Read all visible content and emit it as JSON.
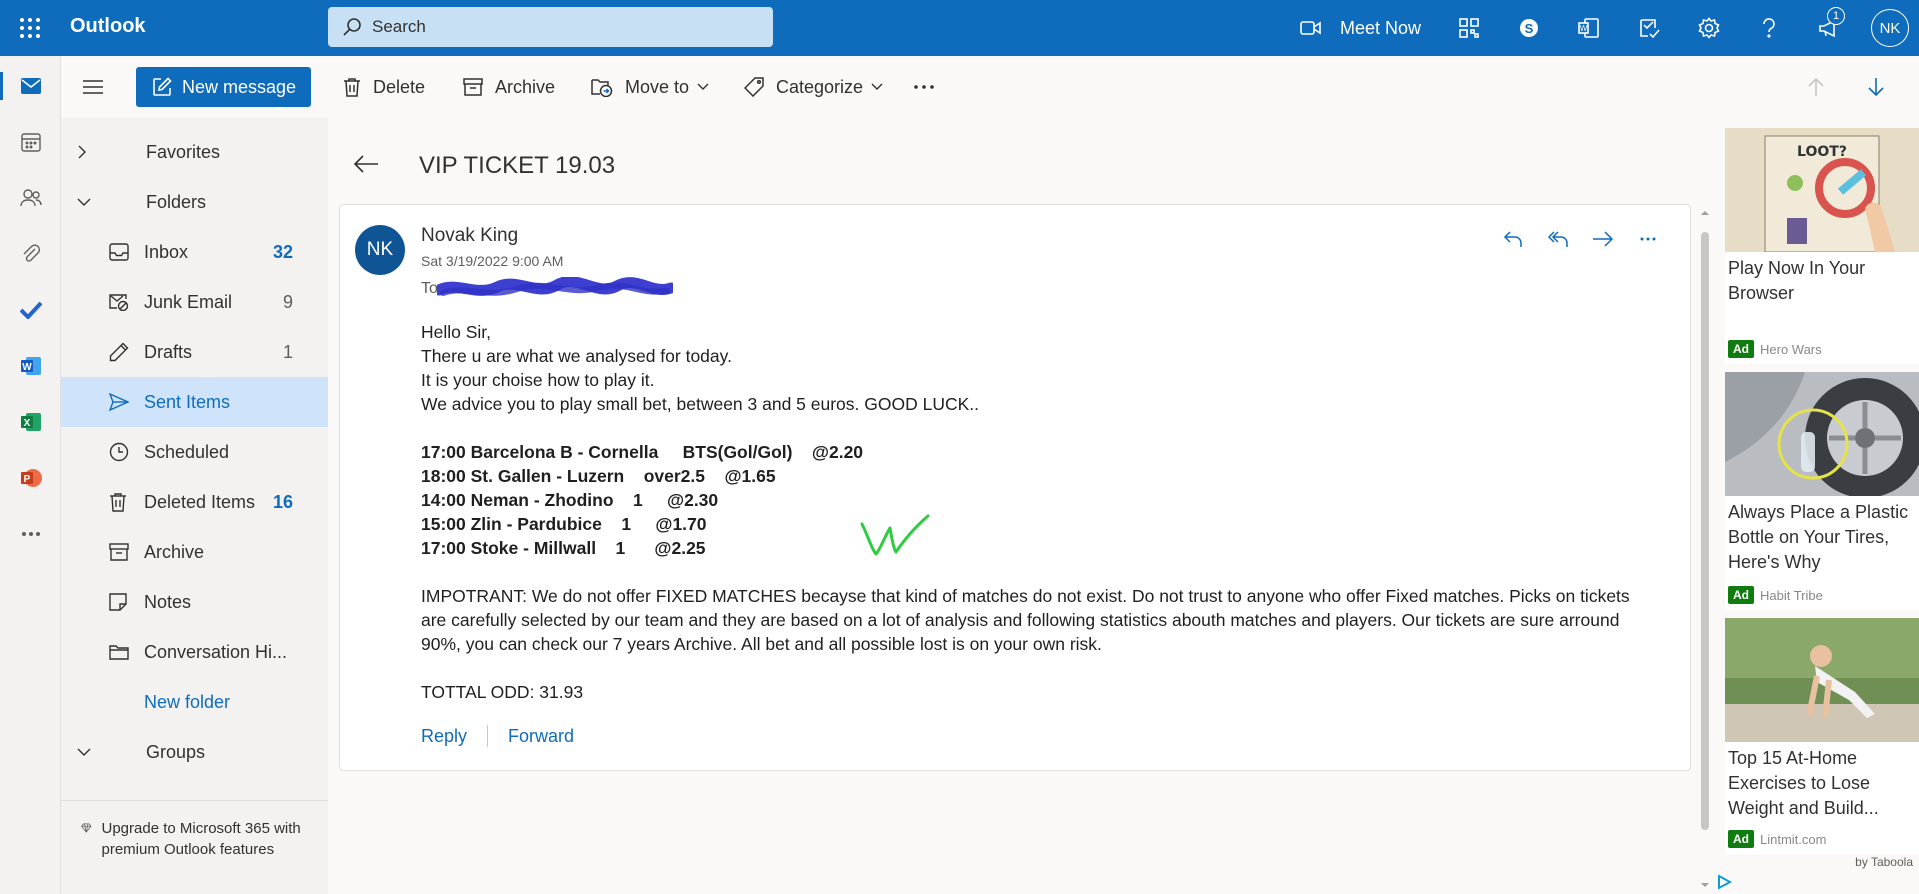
{
  "app": {
    "title": "Outlook",
    "avatar_initials": "NK",
    "notification_count": "1"
  },
  "search": {
    "placeholder": "Search"
  },
  "topbar": {
    "meet_now": "Meet Now"
  },
  "toolbar": {
    "new_message": "New message",
    "delete": "Delete",
    "archive": "Archive",
    "move_to": "Move to",
    "categorize": "Categorize"
  },
  "folders": {
    "favorites": "Favorites",
    "folders": "Folders",
    "items": [
      {
        "label": "Inbox",
        "count": "32"
      },
      {
        "label": "Junk Email",
        "count": "9"
      },
      {
        "label": "Drafts",
        "count": "1"
      },
      {
        "label": "Sent Items",
        "count": ""
      },
      {
        "label": "Scheduled",
        "count": ""
      },
      {
        "label": "Deleted Items",
        "count": "16"
      },
      {
        "label": "Archive",
        "count": ""
      },
      {
        "label": "Notes",
        "count": ""
      },
      {
        "label": "Conversation Hi...",
        "count": ""
      }
    ],
    "new_folder": "New folder",
    "groups": "Groups",
    "upgrade": "Upgrade to Microsoft 365 with premium Outlook features"
  },
  "message": {
    "subject": "VIP TICKET 19.03",
    "sender_initials": "NK",
    "sender": "Novak King",
    "date": "Sat 3/19/2022 9:00 AM",
    "to_label": "To:",
    "greeting": "Hello Sir,",
    "line1": "There u are what we analysed for today.",
    "line2": "It is your choise how to play it.",
    "line3": "We advice you to play small bet, between 3 and 5 euros. GOOD LUCK..",
    "picks": [
      "17:00 Barcelona B - Cornella     BTS(Gol/Gol)    @2.20",
      "18:00 St. Gallen - Luzern    over2.5    @1.65",
      "14:00 Neman - Zhodino    1     @2.30",
      "15:00 Zlin - Pardubice    1     @1.70",
      "17:00 Stoke - Millwall    1      @2.25"
    ],
    "important": "IMPOTRANT: We do not offer FIXED MATCHES becayse that kind of matches do not exist. Do not trust to anyone who offer Fixed matches. Picks on tickets are carefully selected by our team and they are based on a lot of analysis and following statistics abouth matches and players. Our tickets are sure arround 90%, you can check our 7 years Archive. All bet and all possible lost is on your own risk.",
    "total": "TOTTAL ODD: 31.93",
    "reply": "Reply",
    "forward": "Forward"
  },
  "ads": {
    "items": [
      {
        "title": "Play Now In Your Browser",
        "label": "Ad",
        "source": "Hero Wars"
      },
      {
        "title": "Always Place a Plastic Bottle on Your Tires, Here's Why",
        "label": "Ad",
        "source": "Habit Tribe"
      },
      {
        "title": "Top 15 At-Home Exercises to Lose Weight and Build...",
        "label": "Ad",
        "source": "Lintmit.com"
      }
    ],
    "by": "by Taboola"
  },
  "colors": {
    "brand": "#0f6cbd",
    "selected": "#cfe4fa",
    "ad_green": "#107c10"
  }
}
